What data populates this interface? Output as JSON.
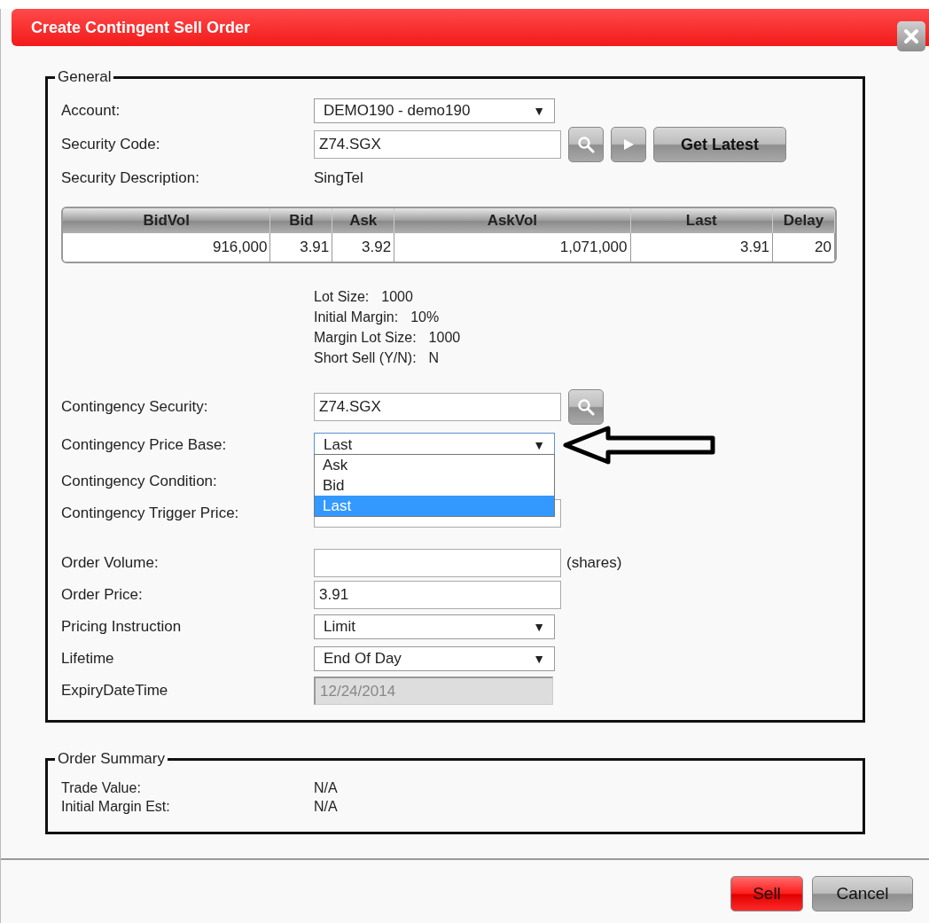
{
  "window": {
    "title": "Create Contingent Sell Order"
  },
  "general": {
    "legend": "General",
    "rows": [
      {
        "kind": "select",
        "label": "Account:",
        "value": "DEMO190 - demo190",
        "arrow": "▼"
      },
      {
        "kind": "input",
        "label": "Security Code:",
        "value": "Z74.SGX",
        "buttons": [
          {
            "kind": "search"
          },
          {
            "kind": "play"
          },
          {
            "kind": "text",
            "label": "Get Latest"
          }
        ]
      },
      {
        "kind": "static",
        "label": "Security Description:",
        "value": "SingTel"
      },
      {
        "kind": "quote",
        "columns": [
          "BidVol",
          "Bid",
          "Ask",
          "AskVol",
          "Last",
          "Delay"
        ],
        "rows": [
          [
            "916,000",
            "3.91",
            "3.92",
            "1,071,000",
            "3.91",
            "20"
          ]
        ]
      },
      {
        "kind": "info",
        "lines": [
          {
            "label": "Lot Size:",
            "value": "1000"
          },
          {
            "label": "Initial Margin:",
            "value": "10%"
          },
          {
            "label": "Margin Lot Size:",
            "value": "1000"
          },
          {
            "label": "Short Sell (Y/N):",
            "value": "N"
          }
        ]
      },
      {
        "kind": "input",
        "label": "Contingency Security:",
        "value": "Z74.SGX",
        "buttons": [
          {
            "kind": "search"
          }
        ]
      },
      {
        "kind": "select",
        "label": "Contingency Price Base:",
        "value": "Last",
        "arrow": "▼",
        "expanded": true,
        "annotated": true,
        "options": [
          {
            "label": "Ask",
            "selected": false
          },
          {
            "label": "Bid",
            "selected": false
          },
          {
            "label": "Last",
            "selected": true
          }
        ]
      },
      {
        "kind": "label",
        "label": "Contingency Condition:"
      },
      {
        "kind": "input",
        "label": "Contingency Trigger Price:"
      },
      {
        "kind": "input",
        "label": "Order Volume:",
        "suffix": "(shares)",
        "gap": true
      },
      {
        "kind": "input",
        "label": "Order Price:",
        "value": "3.91"
      },
      {
        "kind": "select",
        "label": "Pricing Instruction",
        "value": "Limit",
        "arrow": "▼"
      },
      {
        "kind": "select",
        "label": "Lifetime",
        "value": "End Of Day",
        "arrow": "▼"
      },
      {
        "kind": "input",
        "label": "ExpiryDateTime",
        "value": "12/24/2014",
        "disabled": true
      }
    ]
  },
  "summary": {
    "legend": "Order Summary",
    "lines": [
      {
        "label": "Trade Value:",
        "value": "N/A"
      },
      {
        "label": "Initial Margin Est:",
        "value": "N/A"
      }
    ]
  },
  "buttons": [
    {
      "kind": "primary",
      "label": "Sell"
    },
    {
      "kind": "secondary",
      "label": "Cancel"
    }
  ]
}
